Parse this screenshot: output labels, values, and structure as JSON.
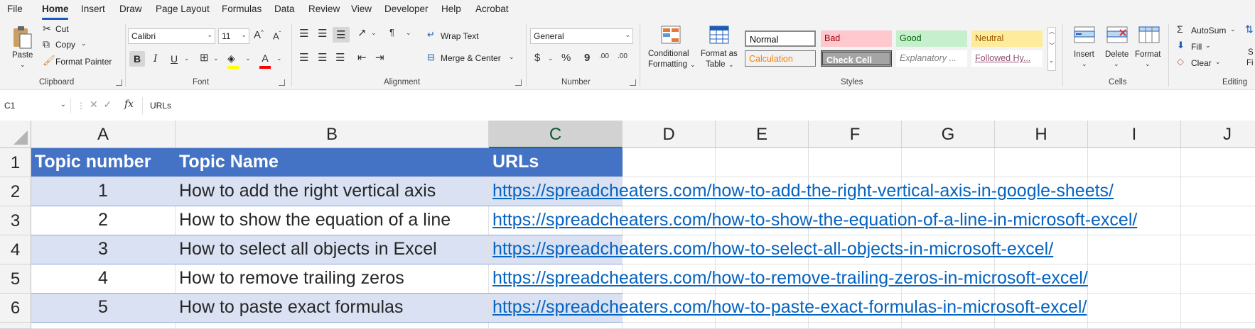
{
  "menu": {
    "items": [
      "File",
      "Home",
      "Insert",
      "Draw",
      "Page Layout",
      "Formulas",
      "Data",
      "Review",
      "View",
      "Developer",
      "Help",
      "Acrobat"
    ],
    "active": "Home"
  },
  "ribbon": {
    "clipboard": {
      "paste": "Paste",
      "cut": "Cut",
      "copy": "Copy",
      "format_painter": "Format Painter",
      "group": "Clipboard"
    },
    "font": {
      "name": "Calibri",
      "size": "11",
      "group": "Font",
      "bold": "B",
      "italic": "I",
      "underline": "U",
      "grow": "A",
      "shrink": "A",
      "font_color_letter": "A"
    },
    "alignment": {
      "wrap_text": "Wrap Text",
      "merge_center": "Merge & Center",
      "group": "Alignment"
    },
    "number": {
      "format": "General",
      "currency": "$",
      "percent": "%",
      "comma": "9",
      "inc_decimal": ".00",
      "dec_decimal": ".00",
      "group": "Number"
    },
    "styles": {
      "conditional_1": "Conditional",
      "conditional_2": "Formatting",
      "format_table_1": "Format as",
      "format_table_2": "Table",
      "cells": [
        {
          "label": "Normal",
          "bg": "#ffffff",
          "color": "#000000"
        },
        {
          "label": "Bad",
          "bg": "#ffc7ce",
          "color": "#9c0006"
        },
        {
          "label": "Good",
          "bg": "#c6efce",
          "color": "#006100"
        },
        {
          "label": "Neutral",
          "bg": "#ffeb9c",
          "color": "#9c5700"
        },
        {
          "label": "Calculation",
          "bg": "#f2f2f2",
          "color": "#fa7d00"
        },
        {
          "label": "Check Cell",
          "bg": "#a5a5a5",
          "color": "#ffffff"
        },
        {
          "label": "Explanatory ...",
          "bg": "#ffffff",
          "color": "#7f7f7f"
        },
        {
          "label": "Followed Hy...",
          "bg": "#ffffff",
          "color": "#954f72"
        }
      ],
      "group": "Styles"
    },
    "cells_group": {
      "insert": "Insert",
      "delete": "Delete",
      "format": "Format",
      "group": "Cells"
    },
    "editing": {
      "autosum": "AutoSum",
      "fill": "Fill",
      "clear": "Clear",
      "sort_partial": "S",
      "find_partial": "Fi",
      "group": "Editing"
    }
  },
  "formula_bar": {
    "name_box": "C1",
    "fx": "fx",
    "content": "URLs"
  },
  "columns": [
    "A",
    "B",
    "C",
    "D",
    "E",
    "F",
    "G",
    "H",
    "I",
    "J"
  ],
  "selected_column": "C",
  "rows": [
    "1",
    "2",
    "3",
    "4",
    "5",
    "6"
  ],
  "table": {
    "headers": [
      "Topic number",
      "Topic Name",
      "URLs"
    ],
    "rows": [
      {
        "num": "1",
        "name": "How to add the right vertical axis",
        "url": "https://spreadcheaters.com/how-to-add-the-right-vertical-axis-in-google-sheets/"
      },
      {
        "num": "2",
        "name": "How to show the equation of a line",
        "url": "https://spreadcheaters.com/how-to-show-the-equation-of-a-line-in-microsoft-excel/"
      },
      {
        "num": "3",
        "name": "How to select all objects in Excel",
        "url": "https://spreadcheaters.com/how-to-select-all-objects-in-microsoft-excel/"
      },
      {
        "num": "4",
        "name": "How to remove trailing zeros",
        "url": "https://spreadcheaters.com/how-to-remove-trailing-zeros-in-microsoft-excel/"
      },
      {
        "num": "5",
        "name": "How to paste exact formulas",
        "url": "https://spreadcheaters.com/how-to-paste-exact-formulas-in-microsoft-excel/"
      }
    ]
  },
  "colors": {
    "header_fill": "#4472c4",
    "band_fill": "#d9e1f2",
    "link": "#0563c1",
    "accent": "#185abd"
  }
}
